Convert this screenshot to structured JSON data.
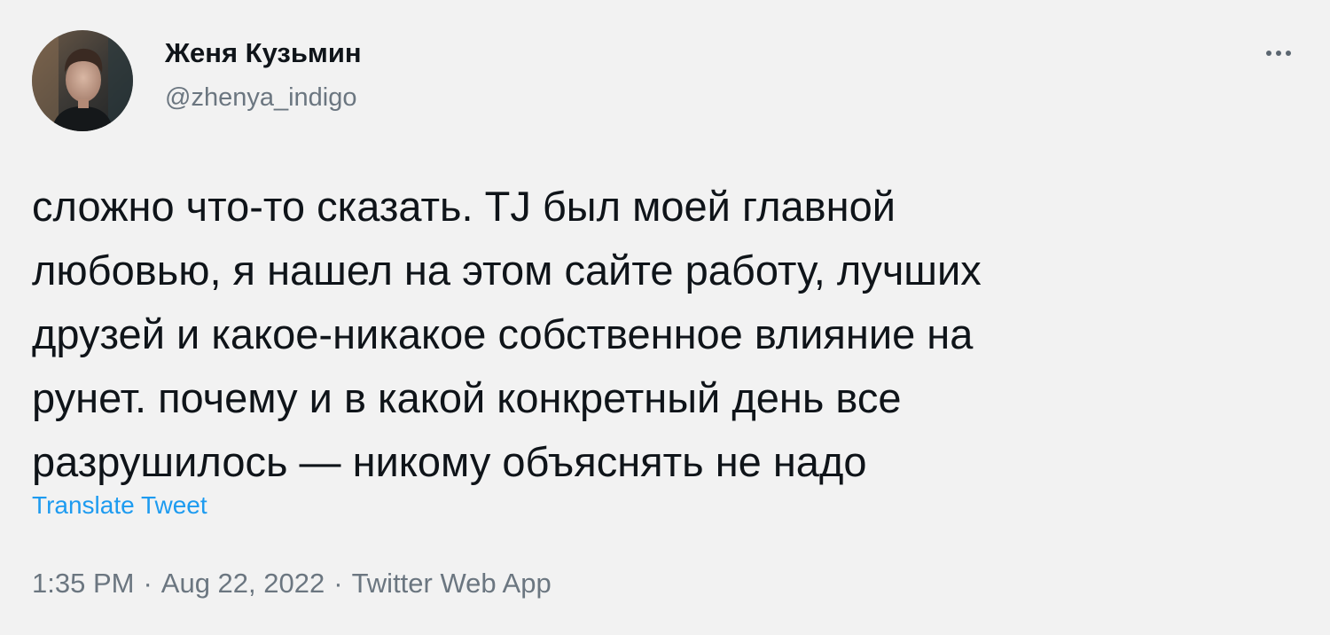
{
  "author": {
    "display_name": "Женя Кузьмин",
    "handle": "@zhenya_indigo",
    "avatar_icon": "user-avatar-photo"
  },
  "more_icon": "more-horizontal-icon",
  "tweet": {
    "lines": [
      "сложно что-то сказать. TJ был моей главной",
      "любовью, я нашел на этом сайте работу, лучших",
      "друзей и какое-никакое собственное влияние на",
      "рунет. почему и в какой конкретный день все",
      "разрушилось — никому объяснять не надо"
    ],
    "translate_label": "Translate Tweet"
  },
  "meta": {
    "time": "1:35 PM",
    "separator": "·",
    "date": "Aug 22, 2022",
    "source": "Twitter Web App"
  },
  "colors": {
    "background": "#f2f2f2",
    "text": "#0f1419",
    "secondary": "#6b7680",
    "link": "#1d9bf0"
  }
}
